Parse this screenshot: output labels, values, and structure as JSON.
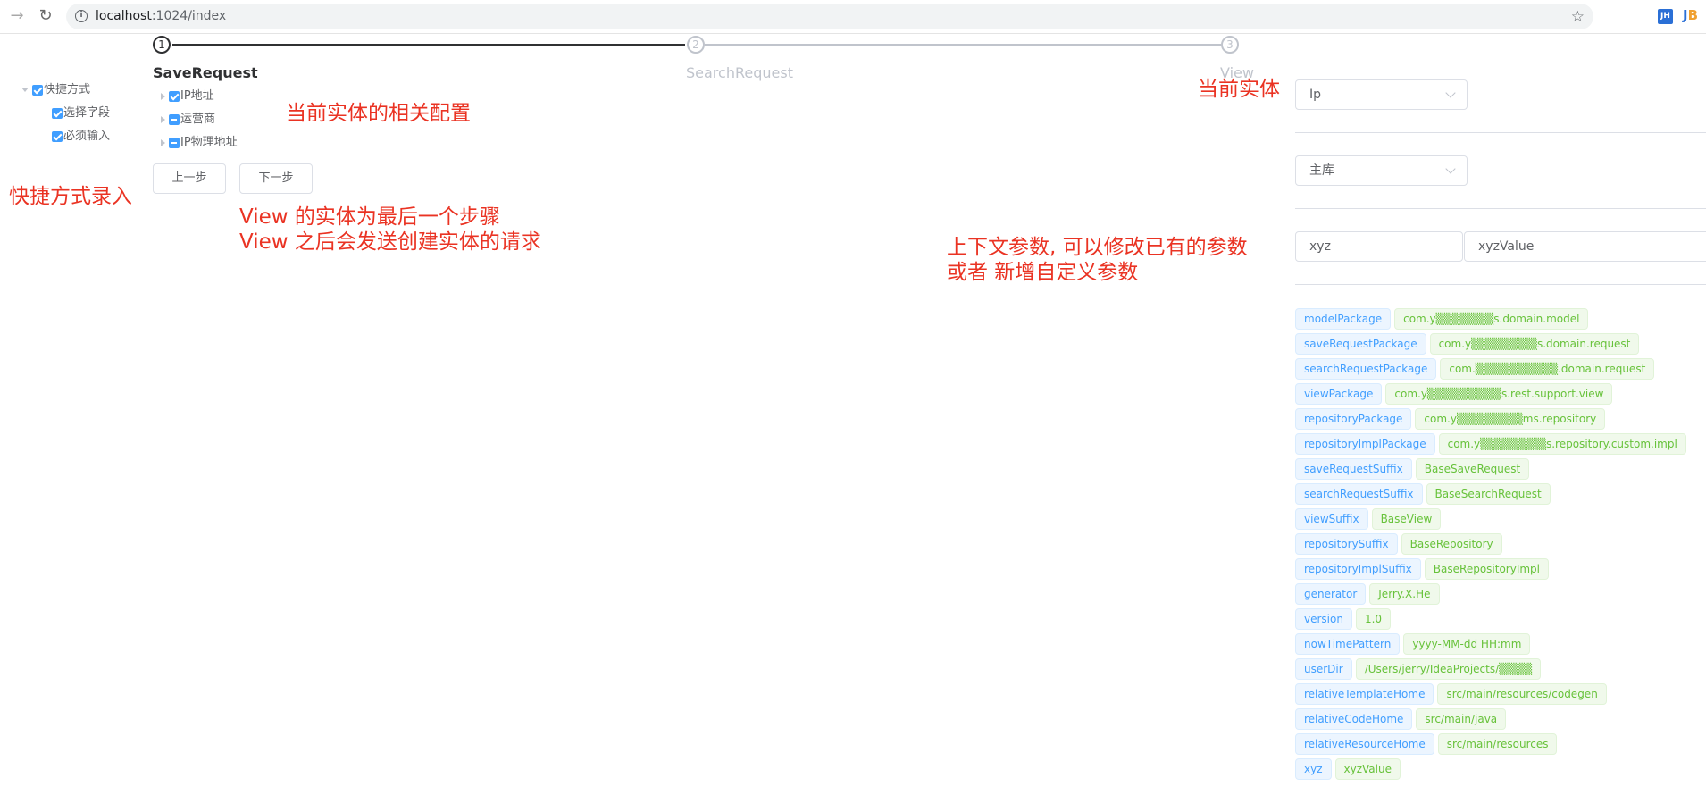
{
  "browser": {
    "url_host": "localhost",
    "url_path": ":1024/index",
    "ext_jh": "JH",
    "ext_jb_j": "J",
    "ext_jb_b": "B"
  },
  "tree": {
    "root_label": "快捷方式",
    "children": [
      "选择字段",
      "必须输入"
    ]
  },
  "steps": [
    {
      "number": "1",
      "title": "SaveRequest",
      "status": "active"
    },
    {
      "number": "2",
      "title": "SearchRequest",
      "status": "wait"
    },
    {
      "number": "3",
      "title": "View",
      "status": "wait"
    }
  ],
  "fields_tree": [
    {
      "label": "IP地址",
      "state": "checked"
    },
    {
      "label": "运营商",
      "state": "indeterminate"
    },
    {
      "label": "IP物理地址",
      "state": "indeterminate"
    }
  ],
  "buttons": {
    "prev": "上一步",
    "next": "下一步"
  },
  "annotations": {
    "shortcut": "快捷方式录入",
    "config": "当前实体的相关配置",
    "view_line1": "View 的实体为最后一个步骤",
    "view_line2": "View 之后会发送创建实体的请求",
    "context_line1": "上下文参数, 可以修改已有的参数",
    "context_line2": "或者 新增自定义参数",
    "current_entity": "当前实体"
  },
  "form": {
    "entity_select": "Ip",
    "db_select": "主库",
    "param_key": "xyz",
    "param_value": "xyzValue"
  },
  "context_params": [
    {
      "key": "modelPackage",
      "value": "com.y▒▒▒▒▒▒▒s.domain.model"
    },
    {
      "key": "saveRequestPackage",
      "value": "com.y▒▒▒▒▒▒▒▒s.domain.request"
    },
    {
      "key": "searchRequestPackage",
      "value": "com.▒▒▒▒▒▒▒▒▒▒.domain.request"
    },
    {
      "key": "viewPackage",
      "value": "com.y▒▒▒▒▒▒▒▒▒s.rest.support.view"
    },
    {
      "key": "repositoryPackage",
      "value": "com.y▒▒▒▒▒▒▒▒ms.repository"
    },
    {
      "key": "repositoryImplPackage",
      "value": "com.y▒▒▒▒▒▒▒▒s.repository.custom.impl"
    },
    {
      "key": "saveRequestSuffix",
      "value": "BaseSaveRequest"
    },
    {
      "key": "searchRequestSuffix",
      "value": "BaseSearchRequest"
    },
    {
      "key": "viewSuffix",
      "value": "BaseView"
    },
    {
      "key": "repositorySuffix",
      "value": "BaseRepository"
    },
    {
      "key": "repositoryImplSuffix",
      "value": "BaseRepositoryImpl"
    },
    {
      "key": "generator",
      "value": "Jerry.X.He"
    },
    {
      "key": "version",
      "value": "1.0"
    },
    {
      "key": "nowTimePattern",
      "value": "yyyy-MM-dd HH:mm"
    },
    {
      "key": "userDir",
      "value": "/Users/jerry/IdeaProjects/▒▒▒▒"
    },
    {
      "key": "relativeTemplateHome",
      "value": "src/main/resources/codegen"
    },
    {
      "key": "relativeCodeHome",
      "value": "src/main/java"
    },
    {
      "key": "relativeResourceHome",
      "value": "src/main/resources"
    },
    {
      "key": "xyz",
      "value": "xyzValue"
    }
  ]
}
